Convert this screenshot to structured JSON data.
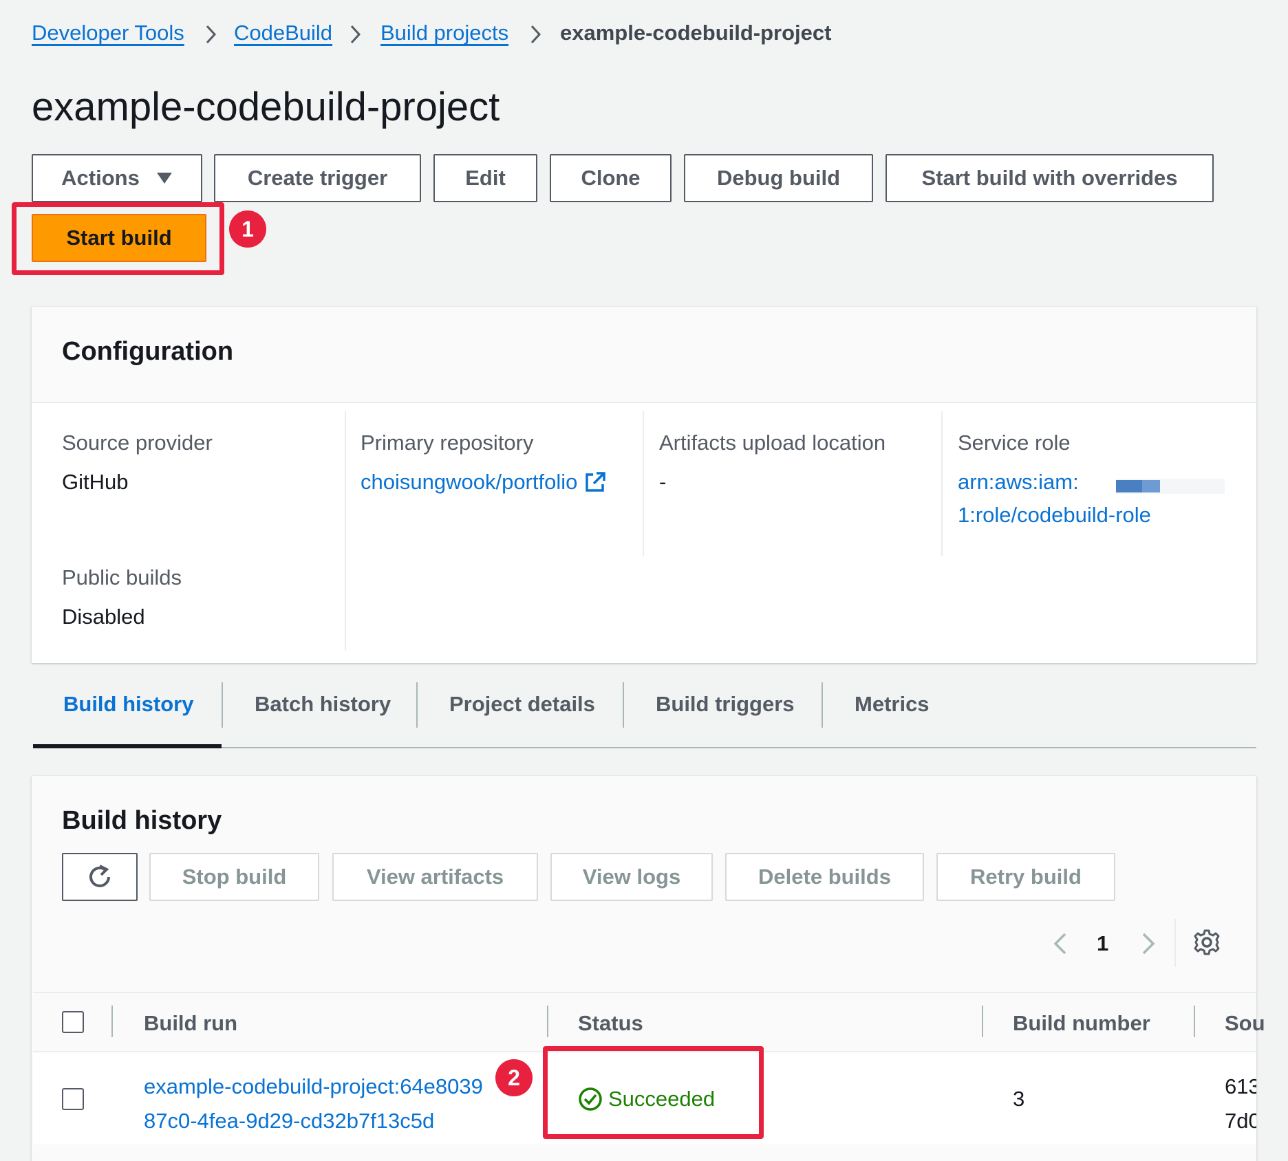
{
  "breadcrumb": {
    "items": [
      "Developer Tools",
      "CodeBuild",
      "Build projects"
    ],
    "current": "example-codebuild-project",
    "separator": "›"
  },
  "page_title": "example-codebuild-project",
  "toolbar": {
    "actions": "Actions",
    "create_trigger": "Create trigger",
    "edit": "Edit",
    "clone": "Clone",
    "debug_build": "Debug build",
    "start_build_overrides": "Start build with overrides",
    "start_build": "Start build"
  },
  "markers": {
    "one": "1",
    "two": "2"
  },
  "configuration": {
    "title": "Configuration",
    "source_provider_label": "Source provider",
    "source_provider_value": "GitHub",
    "primary_repository_label": "Primary repository",
    "primary_repository_value": "choisungwook/portfolio",
    "artifacts_label": "Artifacts upload location",
    "artifacts_value": "-",
    "service_role_label": "Service role",
    "service_role_line1": "arn:aws:iam:",
    "service_role_line2": "1:role/codebuild-role",
    "public_builds_label": "Public builds",
    "public_builds_value": "Disabled"
  },
  "tabs": [
    "Build history",
    "Batch history",
    "Project details",
    "Build triggers",
    "Metrics"
  ],
  "build_history": {
    "title": "Build history",
    "buttons": {
      "stop": "Stop build",
      "view_artifacts": "View artifacts",
      "view_logs": "View logs",
      "delete": "Delete builds",
      "retry": "Retry build"
    },
    "page": "1",
    "columns": [
      "Build run",
      "Status",
      "Build number",
      "Sou"
    ],
    "rows": [
      {
        "build_run_line1": "example-codebuild-project:64e8039",
        "build_run_line2": "87c0-4fea-9d29-cd32b7f13c5d",
        "status": "Succeeded",
        "build_number": "3",
        "source_line1": "613",
        "source_line2": "7d0"
      }
    ]
  },
  "colors": {
    "link": "#0972d3",
    "primary_button": "#ff9900",
    "highlight": "#e8213f",
    "success": "#1d8102"
  }
}
